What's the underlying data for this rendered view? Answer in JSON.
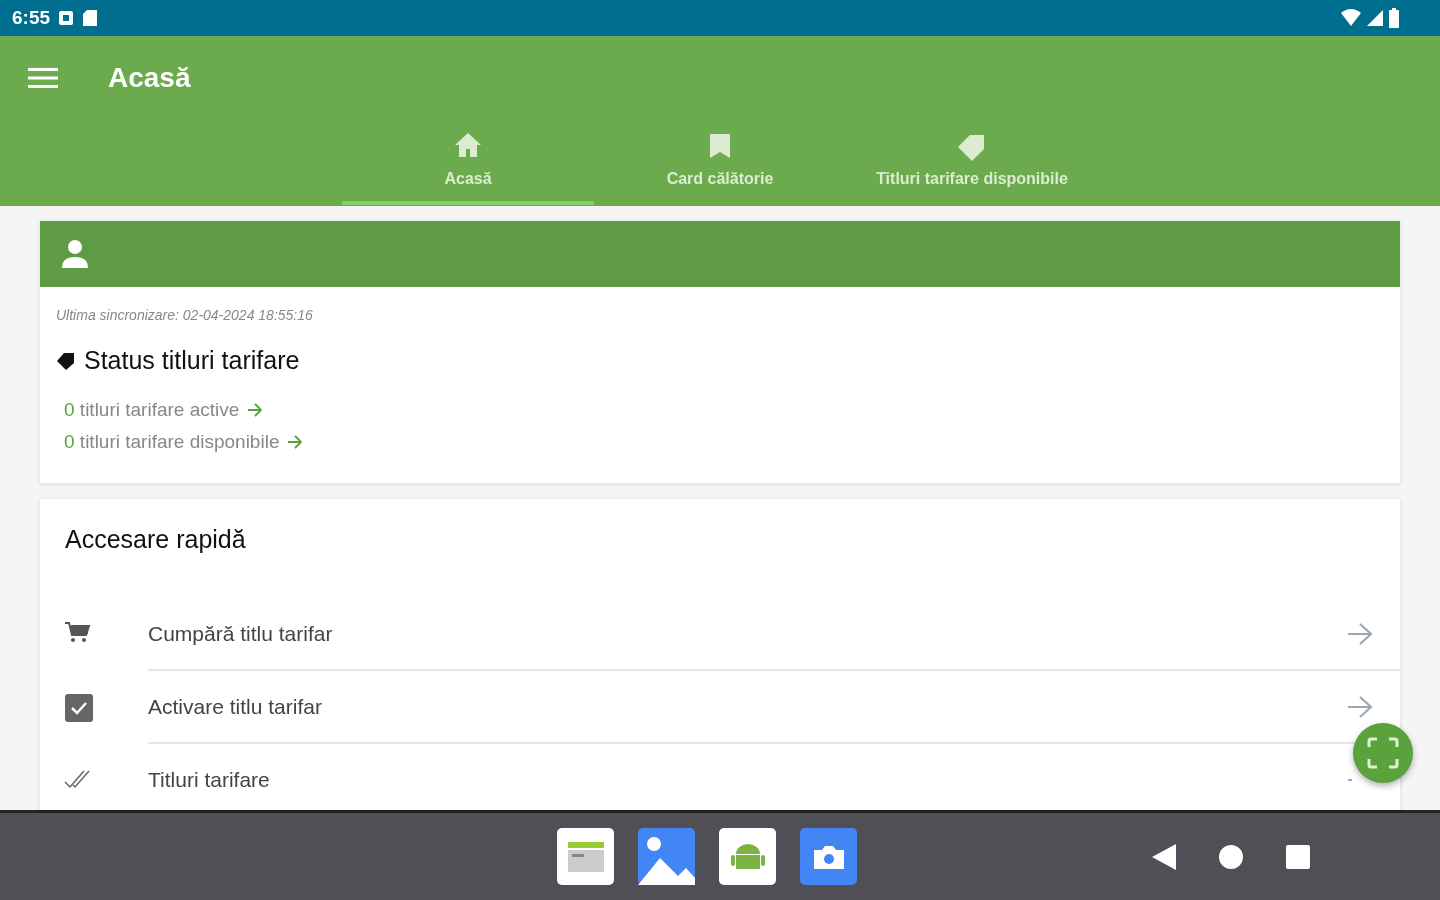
{
  "status_bar": {
    "time": "6:55"
  },
  "app_bar": {
    "title": "Acasă"
  },
  "tabs": [
    {
      "label": "Acasă",
      "kind": "home",
      "selected": true
    },
    {
      "label": "Card călătorie",
      "kind": "bookmark",
      "selected": false
    },
    {
      "label": "Titluri tarifare disponibile",
      "kind": "tag",
      "selected": false
    }
  ],
  "status_card": {
    "last_sync": "Ultima sincronizare: 02-04-2024 18:55:16",
    "title": "Status titluri tarifare",
    "items": [
      {
        "count": "0",
        "label": "titluri tarifare active"
      },
      {
        "count": "0",
        "label": "titluri tarifare disponibile"
      }
    ]
  },
  "quick_access": {
    "title": "Accesare rapidă",
    "items": [
      {
        "kind": "cart",
        "label": "Cumpără titlu tarifar"
      },
      {
        "kind": "checkbox",
        "label": "Activare titlu tarifar"
      },
      {
        "kind": "doublecheck",
        "label": "Titluri tarifare"
      }
    ]
  }
}
